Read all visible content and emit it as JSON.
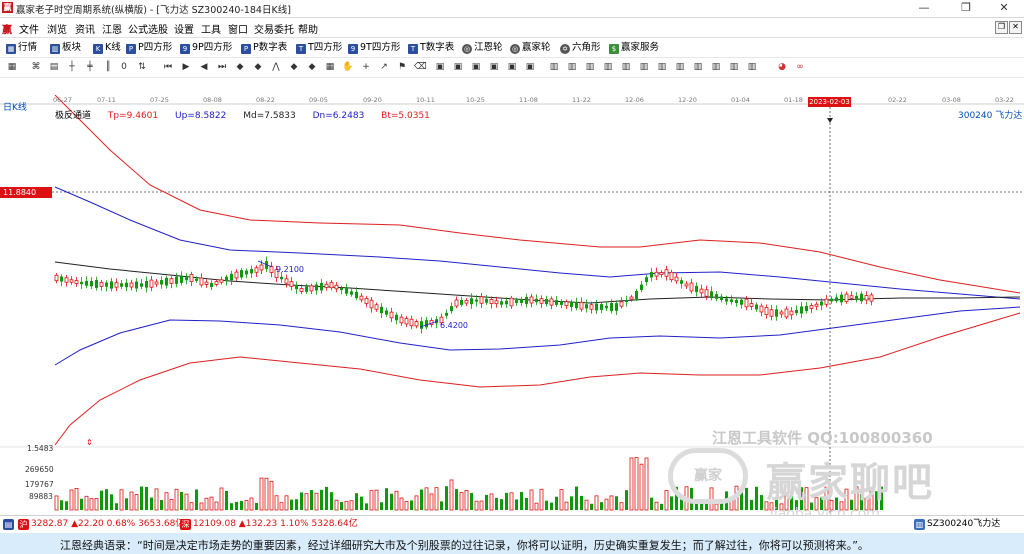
{
  "window": {
    "app_icon": "赢",
    "title": "赢家老子时空周期系统(纵横版) - [飞力达  SZ300240-184日K线]",
    "minimize": "—",
    "maximize": "❐",
    "close": "✕"
  },
  "menu": {
    "items": [
      "文件",
      "浏览",
      "资讯",
      "江恩",
      "公式选股",
      "设置",
      "工具",
      "窗口",
      "交易委托",
      "帮助"
    ],
    "restore_btn": "❐",
    "close_btn": "✕"
  },
  "toolbar1": {
    "items": [
      {
        "label": "行情",
        "icon": "quote-grid-icon"
      },
      {
        "label": "板块",
        "icon": "sector-icon"
      },
      {
        "label": "K线",
        "icon": "kline-icon"
      },
      {
        "label": "P四方形",
        "icon": "p-square-icon"
      },
      {
        "label": "9P四方形",
        "icon": "9p-square-icon"
      },
      {
        "label": "P数字表",
        "icon": "p-number-table-icon"
      },
      {
        "label": "T四方形",
        "icon": "t-square-icon"
      },
      {
        "label": "9T四方形",
        "icon": "9t-square-icon"
      },
      {
        "label": "T数字表",
        "icon": "t-number-table-icon"
      },
      {
        "label": "江恩轮",
        "icon": "gann-wheel-icon"
      },
      {
        "label": "赢家轮",
        "icon": "winner-wheel-icon"
      },
      {
        "label": "六角形",
        "icon": "hexagon-icon"
      },
      {
        "label": "赢家服务",
        "icon": "winner-service-icon"
      }
    ]
  },
  "chart": {
    "period_label": "日K线",
    "stock_label": "300240  飞力达",
    "indicator": {
      "name": "极反通道",
      "tp": "Tp=9.4601",
      "up": "Up=8.5822",
      "md": "Md=7.5833",
      "dn": "Dn=6.2483",
      "bt": "Bt=5.0351"
    },
    "dates": [
      "06-27",
      "07-11",
      "07-25",
      "08-08",
      "08-22",
      "09-05",
      "09-20",
      "10-11",
      "10-25",
      "11-08",
      "11-22",
      "12-06",
      "12-20",
      "01-04",
      "01-18",
      "2023-02-03",
      "02-22",
      "03-08",
      "03-22"
    ],
    "highlight_date": "2023-02-03",
    "price_tag": "11.8840",
    "price_high_note": "9.2100",
    "price_low_note": "6.4200",
    "axis_low": "1.5483",
    "vol_ticks": [
      "269650",
      "179767",
      "89883"
    ],
    "colors": {
      "up": "#e01010",
      "down": "#0a9a0a",
      "tp_bt": "#dd1f1f",
      "up_dn": "#2020c8",
      "md": "#222222"
    }
  },
  "watermark": {
    "line1": "江恩工具软件  QQ:100800360",
    "line2": "赢家聊吧",
    "line3": "liaoba.yjcp.com",
    "seal": "赢家"
  },
  "statusbar": {
    "sh_badge": "沪",
    "sh_text": "3282.87 ▲22.20 0.68% 3653.68亿",
    "sz_badge": "深",
    "sz_text": "12109.08 ▲132.23 1.10% 5328.64亿",
    "right_text": "SZ300240飞力达"
  },
  "quote": "江恩经典语录：“时间是决定市场走势的重要因素，经过详细研究大市及个别股票的过往记录，你将可以证明，历史确实重复发生；而了解过往，你将可以预测将来。”。"
}
